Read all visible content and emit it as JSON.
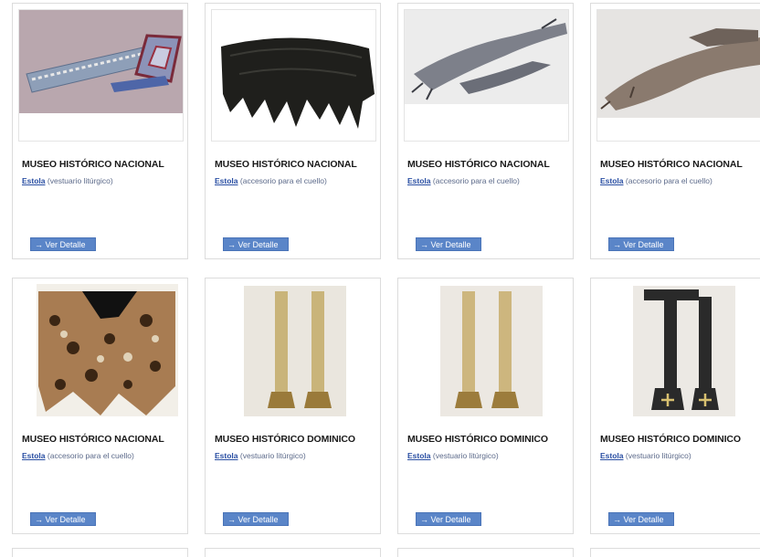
{
  "items": [
    {
      "museum": "MUSEO HISTÓRICO NACIONAL",
      "name": "Estola",
      "type": "(vestuario litúrgico)",
      "button": "→ Ver Detalle",
      "image": "stole-embroidered-icon"
    },
    {
      "museum": "MUSEO HISTÓRICO NACIONAL",
      "name": "Estola",
      "type": "(accesorio para el cuello)",
      "button": "→ Ver Detalle",
      "image": "black-fur-stole-icon"
    },
    {
      "museum": "MUSEO HISTÓRICO NACIONAL",
      "name": "Estola",
      "type": "(accesorio para el cuello)",
      "button": "→ Ver Detalle",
      "image": "grey-fur-stole-icon"
    },
    {
      "museum": "MUSEO HISTÓRICO NACIONAL",
      "name": "Estola",
      "type": "(accesorio para el cuello)",
      "button": "→ Ver Detalle",
      "image": "fox-fur-stole-icon"
    },
    {
      "museum": "MUSEO HISTÓRICO NACIONAL",
      "name": "Estola",
      "type": "(accesorio para el cuello)",
      "button": "→ Ver Detalle",
      "image": "leopard-print-stole-icon"
    },
    {
      "museum": "MUSEO HISTÓRICO DOMINICO",
      "name": "Estola",
      "type": "(vestuario litúrgico)",
      "button": "→ Ver Detalle",
      "image": "gold-liturgical-stole-icon"
    },
    {
      "museum": "MUSEO HISTÓRICO DOMINICO",
      "name": "Estola",
      "type": "(vestuario litúrgico)",
      "button": "→ Ver Detalle",
      "image": "gold-liturgical-stole-icon"
    },
    {
      "museum": "MUSEO HISTÓRICO DOMINICO",
      "name": "Estola",
      "type": "(vestuario litúrgico)",
      "button": "→ Ver Detalle",
      "image": "black-cross-stole-icon"
    }
  ]
}
